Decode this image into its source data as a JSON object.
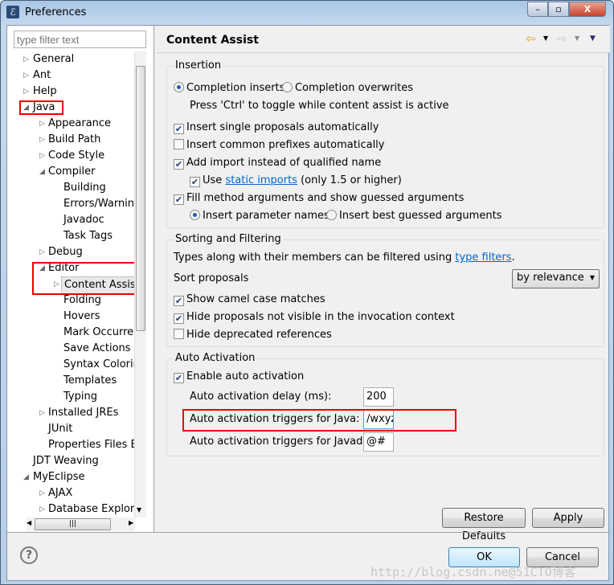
{
  "window": {
    "title": "Preferences",
    "min": "–",
    "max": "▫",
    "close": "X"
  },
  "filter": {
    "placeholder": "type filter text"
  },
  "tree": [
    {
      "label": "General",
      "level": 0,
      "state": "collapsed"
    },
    {
      "label": "Ant",
      "level": 0,
      "state": "collapsed"
    },
    {
      "label": "Help",
      "level": 0,
      "state": "collapsed"
    },
    {
      "label": "Java",
      "level": 0,
      "state": "expanded"
    },
    {
      "label": "Appearance",
      "level": 1,
      "state": "collapsed"
    },
    {
      "label": "Build Path",
      "level": 1,
      "state": "collapsed"
    },
    {
      "label": "Code Style",
      "level": 1,
      "state": "collapsed"
    },
    {
      "label": "Compiler",
      "level": 1,
      "state": "expanded"
    },
    {
      "label": "Building",
      "level": 2,
      "state": "leaf"
    },
    {
      "label": "Errors/Warning",
      "level": 2,
      "state": "leaf"
    },
    {
      "label": "Javadoc",
      "level": 2,
      "state": "leaf"
    },
    {
      "label": "Task Tags",
      "level": 2,
      "state": "leaf"
    },
    {
      "label": "Debug",
      "level": 1,
      "state": "collapsed"
    },
    {
      "label": "Editor",
      "level": 1,
      "state": "expanded"
    },
    {
      "label": "Content Assist",
      "level": 2,
      "state": "collapsed",
      "selected": true
    },
    {
      "label": "Folding",
      "level": 2,
      "state": "leaf"
    },
    {
      "label": "Hovers",
      "level": 2,
      "state": "leaf"
    },
    {
      "label": "Mark Occurren",
      "level": 2,
      "state": "leaf"
    },
    {
      "label": "Save Actions",
      "level": 2,
      "state": "leaf"
    },
    {
      "label": "Syntax Coloring",
      "level": 2,
      "state": "leaf"
    },
    {
      "label": "Templates",
      "level": 2,
      "state": "leaf"
    },
    {
      "label": "Typing",
      "level": 2,
      "state": "leaf"
    },
    {
      "label": "Installed JREs",
      "level": 1,
      "state": "collapsed"
    },
    {
      "label": "JUnit",
      "level": 1,
      "state": "leaf"
    },
    {
      "label": "Properties Files Ed",
      "level": 1,
      "state": "leaf"
    },
    {
      "label": "JDT Weaving",
      "level": 0,
      "state": "leaf"
    },
    {
      "label": "MyEclipse",
      "level": 0,
      "state": "expanded"
    },
    {
      "label": "AJAX",
      "level": 1,
      "state": "collapsed"
    },
    {
      "label": "Database Explorer",
      "level": 1,
      "state": "collapsed"
    }
  ],
  "page": {
    "title": "Content Assist"
  },
  "insertion": {
    "label": "Insertion",
    "completion_inserts": "Completion inserts",
    "completion_inserts_on": true,
    "completion_overwrites": "Completion overwrites",
    "hint": "Press 'Ctrl' to toggle while content assist is active",
    "single": {
      "label": "Insert single proposals automatically",
      "checked": true
    },
    "prefixes": {
      "label": "Insert common prefixes automatically",
      "checked": false
    },
    "add_import": {
      "label": "Add import instead of qualified name",
      "checked": true
    },
    "static_use": "Use",
    "static_link": "static imports",
    "static_rest": "(only 1.5 or higher)",
    "static_checked": true,
    "fill": {
      "label": "Fill method arguments and show guessed arguments",
      "checked": true
    },
    "param_names": "Insert parameter names",
    "param_names_on": true,
    "best_guessed": "Insert best guessed arguments"
  },
  "sorting": {
    "label": "Sorting and Filtering",
    "desc": "Types along with their members can be filtered using",
    "link": "type filters",
    "dot": ".",
    "sort_label": "Sort proposals",
    "sort_value": "by relevance",
    "camel": {
      "label": "Show camel case matches",
      "checked": true
    },
    "hide_invisible": {
      "label": "Hide proposals not visible in the invocation context",
      "checked": true
    },
    "hide_deprecated": {
      "label": "Hide deprecated references",
      "checked": false
    }
  },
  "auto": {
    "label": "Auto Activation",
    "enable": {
      "label": "Enable auto activation",
      "checked": true
    },
    "delay_label": "Auto activation delay (ms):",
    "delay_value": "200",
    "java_label": "Auto activation triggers for Java:",
    "java_value": "/wxyz",
    "javadoc_label": "Auto activation triggers for Javadoc:",
    "javadoc_value": "@#"
  },
  "buttons": {
    "restore": "Restore Defaults",
    "apply": "Apply",
    "ok": "OK",
    "cancel": "Cancel"
  },
  "watermark": "http://blog.csdn.ne@51CTO博客",
  "colors": {
    "highlight": "#e00000",
    "link": "#0066cc"
  }
}
